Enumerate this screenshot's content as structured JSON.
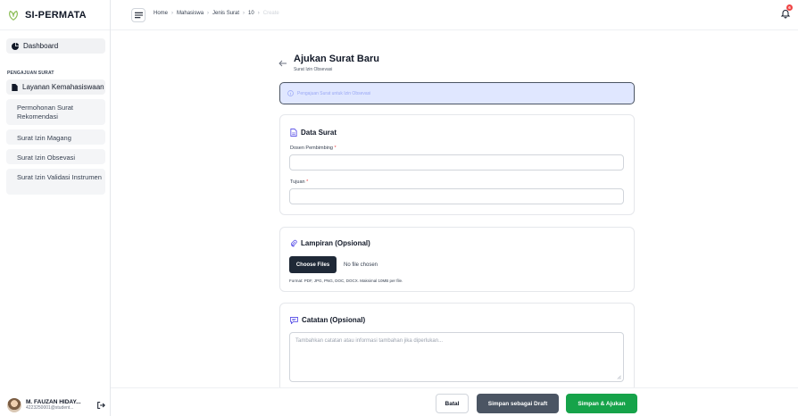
{
  "app": {
    "name": "SI-PERMATA"
  },
  "sidebar": {
    "dashboard_label": "Dashboard",
    "section_label": "PENGAJUAN SURAT",
    "group_label": "Layanan Kemahasiswaan",
    "items": [
      {
        "label": "Permohonan Surat Rekomendasi"
      },
      {
        "label": "Surat Izin Magang"
      },
      {
        "label": "Surat Izin Obsevasi"
      },
      {
        "label": "Surat Izin Validasi Instrumen"
      }
    ],
    "user": {
      "name": "M. FAUZAN HIDAY...",
      "email": "4223250001@student..."
    }
  },
  "topbar": {
    "breadcrumbs": [
      "Home",
      "Mahasiswa",
      "Jenis Surat",
      "10",
      "Create"
    ],
    "notification_count": "6"
  },
  "page": {
    "title": "Ajukan Surat Baru",
    "subtitle": "Surat Izin Obsevasi",
    "info": "Pengajuan Surat untuk Izin Obsevasi"
  },
  "data_surat": {
    "title": "Data Surat",
    "dosen_label": "Dosen Pembimbing",
    "tujuan_label": "Tujuan",
    "required_mark": "*",
    "dosen_value": "",
    "tujuan_value": ""
  },
  "lampiran": {
    "title": "Lampiran (Opsional)",
    "button_label": "Choose Files",
    "status": "No file chosen",
    "hint": "Format: PDF, JPG, PNG, DOC, DOCX. Maksimal 10MB per file."
  },
  "catatan": {
    "title": "Catatan (Opsional)",
    "placeholder": "Tambahkan catatan atau informasi tambahan jika diperlukan..."
  },
  "footer": {
    "cancel_label": "Batal",
    "draft_label": "Simpan sebagai Draft",
    "submit_label": "Simpan & Ajukan"
  },
  "colors": {
    "accent_green": "#16a34a",
    "draft_gray": "#4b5563",
    "info_bg": "#e0e7ff",
    "badge_red": "#ef4444"
  },
  "icons": {
    "brand": "leaf-logo-icon",
    "dashboard": "pie-chart-icon",
    "group": "document-icon",
    "menu": "hamburger-menu-icon",
    "bell": "bell-icon",
    "back": "arrow-left-icon",
    "info": "info-circle-icon",
    "data_surat": "file-text-icon",
    "lampiran": "paperclip-icon",
    "catatan": "chat-bubble-icon",
    "logout": "logout-icon"
  }
}
